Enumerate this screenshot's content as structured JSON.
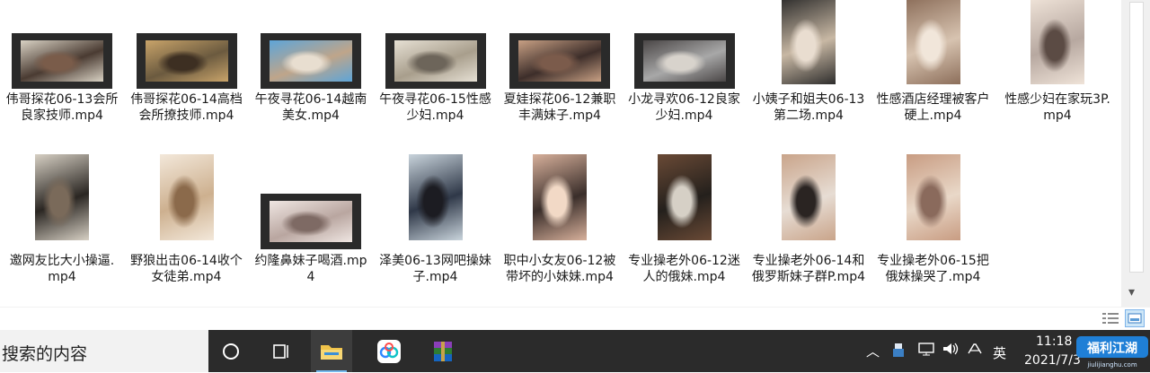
{
  "files": [
    {
      "name": "伟哥探花06-13会所良家技师.mp4",
      "thumb": "video",
      "palette": [
        "#4a3b32",
        "#d9d2c4",
        "#7a5c4a"
      ]
    },
    {
      "name": "伟哥探花06-14高档会所撩技师.mp4",
      "thumb": "video",
      "palette": [
        "#6b5a3f",
        "#c9a46a",
        "#3d2f22"
      ]
    },
    {
      "name": "午夜寻花06-14越南美女.mp4",
      "thumb": "video",
      "palette": [
        "#bfa58a",
        "#5ea5d8",
        "#e8ded0"
      ]
    },
    {
      "name": "午夜寻花06-15性感少妇.mp4",
      "thumb": "video",
      "palette": [
        "#a89e8c",
        "#e6e0d4",
        "#6d655a"
      ]
    },
    {
      "name": "夏娃探花06-12兼职丰满妹子.mp4",
      "thumb": "video",
      "palette": [
        "#3d2e2a",
        "#c8a084",
        "#7b5b4b"
      ]
    },
    {
      "name": "小龙寻欢06-12良家少妇.mp4",
      "thumb": "video",
      "palette": [
        "#a8a8a8",
        "#4a4646",
        "#d8d3cc"
      ]
    },
    {
      "name": "小姨子和姐夫06-13第二场.mp4",
      "thumb": "image",
      "palette": [
        "#c8b8a4",
        "#2e2d2c",
        "#e9ddd0"
      ]
    },
    {
      "name": "性感酒店经理被客户硬上.mp4",
      "thumb": "image",
      "palette": [
        "#d7c3b0",
        "#8c6e5a",
        "#f1e6da"
      ]
    },
    {
      "name": "性感少妇在家玩3P.mp4",
      "thumb": "image",
      "palette": [
        "#b7a8a0",
        "#efe3d8",
        "#5b4b44"
      ]
    },
    {
      "name": "邀网友比大小操逼.mp4",
      "thumb": "image",
      "palette": [
        "#2a2622",
        "#d7d0c4",
        "#7a6a5a"
      ]
    },
    {
      "name": "野狼出击06-14收个女徒弟.mp4",
      "thumb": "image",
      "palette": [
        "#cdb08f",
        "#f3e8da",
        "#8b6a4b"
      ]
    },
    {
      "name": "约隆鼻妹子喝酒.mp4",
      "thumb": "video",
      "palette": [
        "#b9a6a0",
        "#efe6e2",
        "#7e6a64"
      ]
    },
    {
      "name": "泽美06-13网吧操妹子.mp4",
      "thumb": "image",
      "palette": [
        "#2f3848",
        "#c9d4dc",
        "#1c1c22"
      ]
    },
    {
      "name": "职中小女友06-12被带坏的小妹妹.mp4",
      "thumb": "image",
      "palette": [
        "#3a2e2a",
        "#d7b09b",
        "#f2d9c6"
      ]
    },
    {
      "name": "专业操老外06-12迷人的俄妹.mp4",
      "thumb": "image",
      "palette": [
        "#24201c",
        "#6a4a36",
        "#d6d0c6"
      ]
    },
    {
      "name": "专业操老外06-14和俄罗斯妹子群P.mp4",
      "thumb": "image",
      "palette": [
        "#e7ddd4",
        "#c9a48a",
        "#2a2422"
      ]
    },
    {
      "name": "专业操老外06-15把俄妹操哭了.mp4",
      "thumb": "image",
      "palette": [
        "#e9d8c8",
        "#c89c82",
        "#8a6a5c"
      ]
    }
  ],
  "taskbar": {
    "search_placeholder": "搜索的内容",
    "ime": "英",
    "time": "11:18",
    "date": "2021/7/3",
    "watermark": "jiulijianghu.com"
  },
  "colors": {
    "taskbar_bg": "#2b2b2b",
    "accent": "#76b9ed"
  }
}
